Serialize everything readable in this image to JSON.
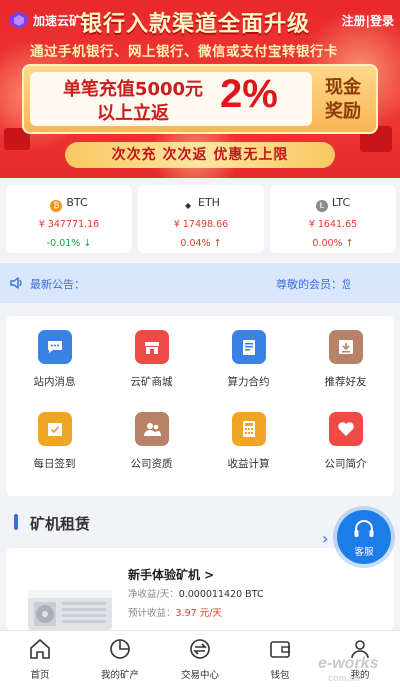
{
  "header": {
    "app_name": "加速云矿",
    "login_label": "注册|登录"
  },
  "banner": {
    "title": "银行入款渠道全面升级",
    "subtitle": "通过手机银行、网上银行、微信或支付宝转银行卡",
    "promo_line1": "单笔充值5000元",
    "promo_line2": "以上立返",
    "promo_percent": "2%",
    "promo_right_line1": "现金",
    "promo_right_line2": "奖励",
    "slogan": "次次充 次次返 优惠无上限"
  },
  "tickers": [
    {
      "symbol": "BTC",
      "price": "¥ 347771.16",
      "change": "-0.01%",
      "trend": "down",
      "icon": "bitcoin-icon",
      "color": "#f7931a"
    },
    {
      "symbol": "ETH",
      "price": "¥ 17498.66",
      "change": "0.04%",
      "trend": "up",
      "icon": "ethereum-icon",
      "color": "#333333"
    },
    {
      "symbol": "LTC",
      "price": "¥ 1641.65",
      "change": "0.00%",
      "trend": "up",
      "icon": "litecoin-icon",
      "color": "#8a8a8a"
    }
  ],
  "notice": {
    "label": "最新公告：",
    "message": "尊敬的会员：您好"
  },
  "grid": [
    {
      "label": "站内消息",
      "icon": "message-icon",
      "color": "#3b82e6"
    },
    {
      "label": "云矿商城",
      "icon": "store-icon",
      "color": "#ef4b46"
    },
    {
      "label": "算力合约",
      "icon": "contract-icon",
      "color": "#3b82e6"
    },
    {
      "label": "推荐好友",
      "icon": "recommend-icon",
      "color": "#b88268"
    },
    {
      "label": "每日签到",
      "icon": "checkin-icon",
      "color": "#f0a526"
    },
    {
      "label": "公司资质",
      "icon": "qualification-icon",
      "color": "#b88268"
    },
    {
      "label": "收益计算",
      "icon": "calculator-icon",
      "color": "#f0a526"
    },
    {
      "label": "公司简介",
      "icon": "heart-icon",
      "color": "#ef4b46"
    }
  ],
  "section": {
    "title": "矿机租赁",
    "arrow": "›"
  },
  "service": {
    "label": "客服"
  },
  "product": {
    "name": "新手体验矿机 >",
    "income_label": "净收益/天：",
    "income_value": "0.000011420 BTC",
    "estimate_label": "预计收益：",
    "estimate_value": "3.97 元/天"
  },
  "nav": [
    {
      "label": "首页",
      "icon": "home-icon"
    },
    {
      "label": "我的矿产",
      "icon": "pie-chart-icon"
    },
    {
      "label": "交易中心",
      "icon": "exchange-icon"
    },
    {
      "label": "钱包",
      "icon": "wallet-icon"
    },
    {
      "label": "我的",
      "icon": "user-icon"
    }
  ],
  "watermark": {
    "text": "e-works",
    "sub": "com.cn"
  },
  "colors": {
    "banner_red": "#e8282b",
    "accent_blue": "#3a6fd8",
    "up_red": "#e23b2b",
    "down_green": "#1aa34a"
  }
}
